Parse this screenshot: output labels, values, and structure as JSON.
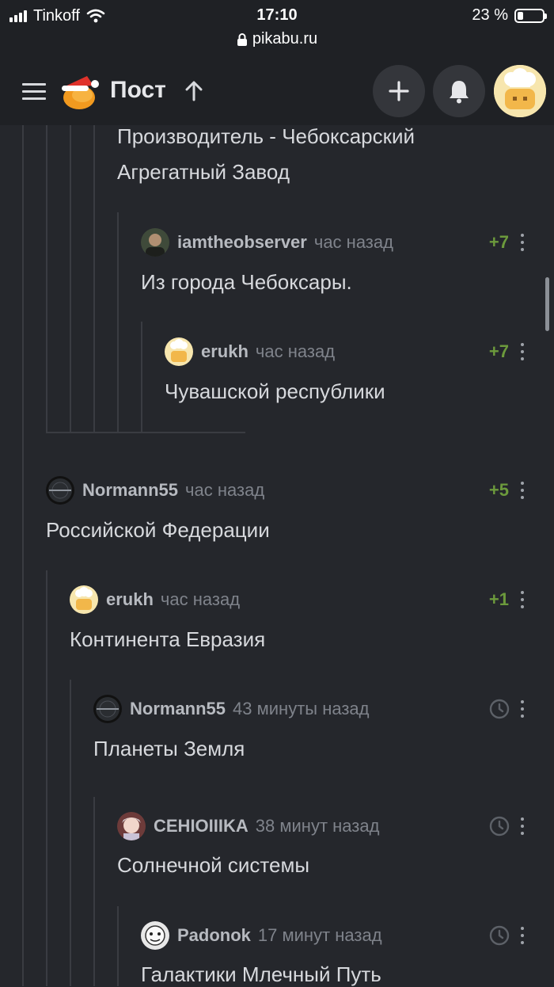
{
  "status_bar": {
    "carrier": "Tinkoff",
    "time": "17:10",
    "battery_label": "23 %",
    "battery_level": 0.23,
    "url": "pikabu.ru"
  },
  "header": {
    "title": "Пост"
  },
  "comments": [
    {
      "text_line1": "Производитель - Чебоксарский",
      "text_line2": "Агрегатный Завод"
    },
    {
      "username": "iamtheobserver",
      "time": "час назад",
      "rating": "+7",
      "text": "Из города Чебоксары."
    },
    {
      "username": "erukh",
      "time": "час назад",
      "rating": "+7",
      "text": "Чувашской республики"
    },
    {
      "username": "Normann55",
      "time": "час назад",
      "rating": "+5",
      "text": "Российской Федерации"
    },
    {
      "username": "erukh",
      "time": "час назад",
      "rating": "+1",
      "text": "Континента Евразия"
    },
    {
      "username": "Normann55",
      "time": "43 минуты назад",
      "text": "Планеты Земля"
    },
    {
      "username": "CEHIOIIIKA",
      "time": "38 минут назад",
      "text": "Солнечной системы"
    },
    {
      "username": "Padonok",
      "time": "17 минут назад",
      "text": "Галактики Млечный Путь"
    }
  ],
  "icons": [
    "signal-icon",
    "wifi-icon",
    "battery-icon",
    "lock-icon",
    "menu-icon",
    "pikabu-logo",
    "arrow-up-icon",
    "plus-icon",
    "bell-icon",
    "clock-icon",
    "more-icon"
  ]
}
